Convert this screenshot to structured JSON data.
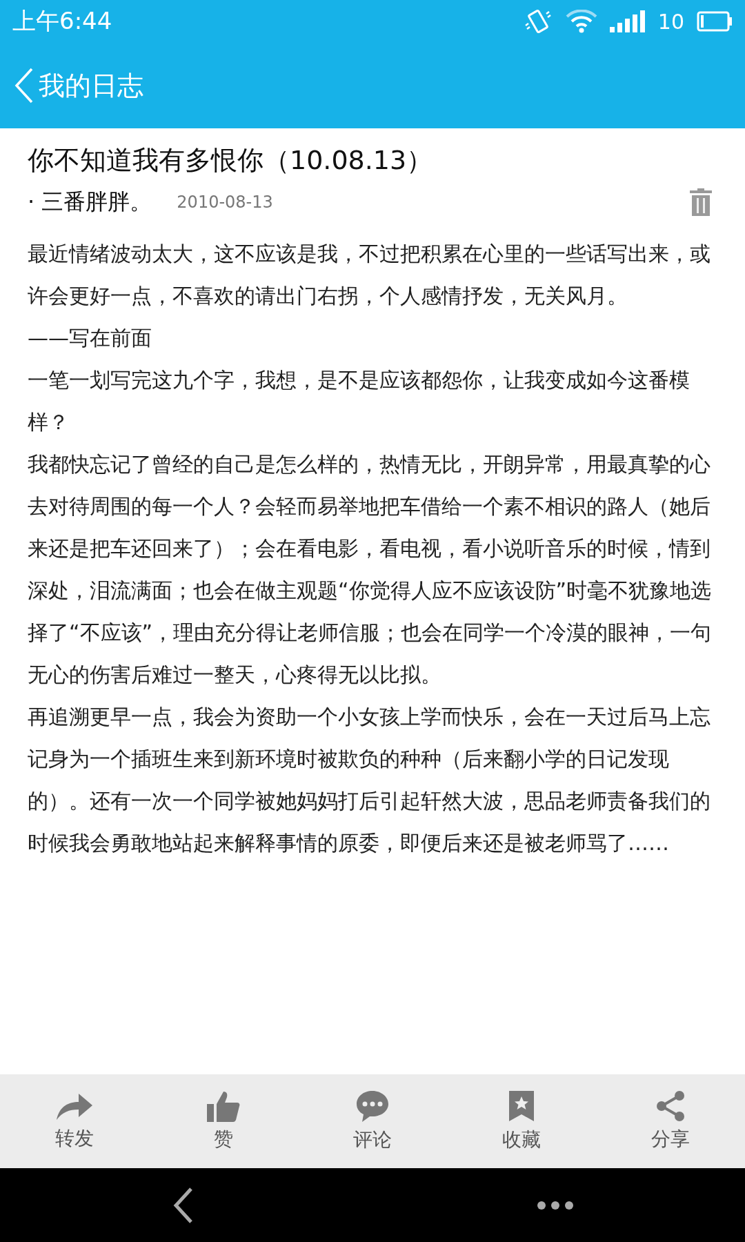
{
  "status_bar": {
    "time": "上午6:44",
    "battery": "10"
  },
  "header": {
    "title": "我的日志"
  },
  "post": {
    "title": "你不知道我有多恨你（10.08.13）",
    "author": "· 三番胖胖。",
    "date": "2010-08-13",
    "paragraphs": [
      "最近情绪波动太大，这不应该是我，不过把积累在心里的一些话写出来，或许会更好一点，不喜欢的请出门右拐，个人感情抒发，无关风月。",
      "——写在前面",
      "一笔一划写完这九个字，我想，是不是应该都怨你，让我变成如今这番模样？",
      "我都快忘记了曾经的自己是怎么样的，热情无比，开朗异常，用最真挚的心去对待周围的每一个人？会轻而易举地把车借给一个素不相识的路人（她后来还是把车还回来了）；会在看电影，看电视，看小说听音乐的时候，情到深处，泪流满面；也会在做主观题“你觉得人应不应该设防”时毫不犹豫地选择了“不应该”，理由充分得让老师信服；也会在同学一个冷漠的眼神，一句无心的伤害后难过一整天，心疼得无以比拟。",
      "再追溯更早一点，我会为资助一个小女孩上学而快乐，会在一天过后马上忘记身为一个插班生来到新环境时被欺负的种种（后来翻小学的日记发现的）。还有一次一个同学被她妈妈打后引起轩然大波，思品老师责备我们的时候我会勇敢地站起来解释事情的原委，即便后来还是被老师骂了……"
    ]
  },
  "actions": [
    {
      "kind": "forward",
      "label": "转发"
    },
    {
      "kind": "like",
      "label": "赞"
    },
    {
      "kind": "comment",
      "label": "评论"
    },
    {
      "kind": "favorite",
      "label": "收藏"
    },
    {
      "kind": "share",
      "label": "分享"
    }
  ]
}
